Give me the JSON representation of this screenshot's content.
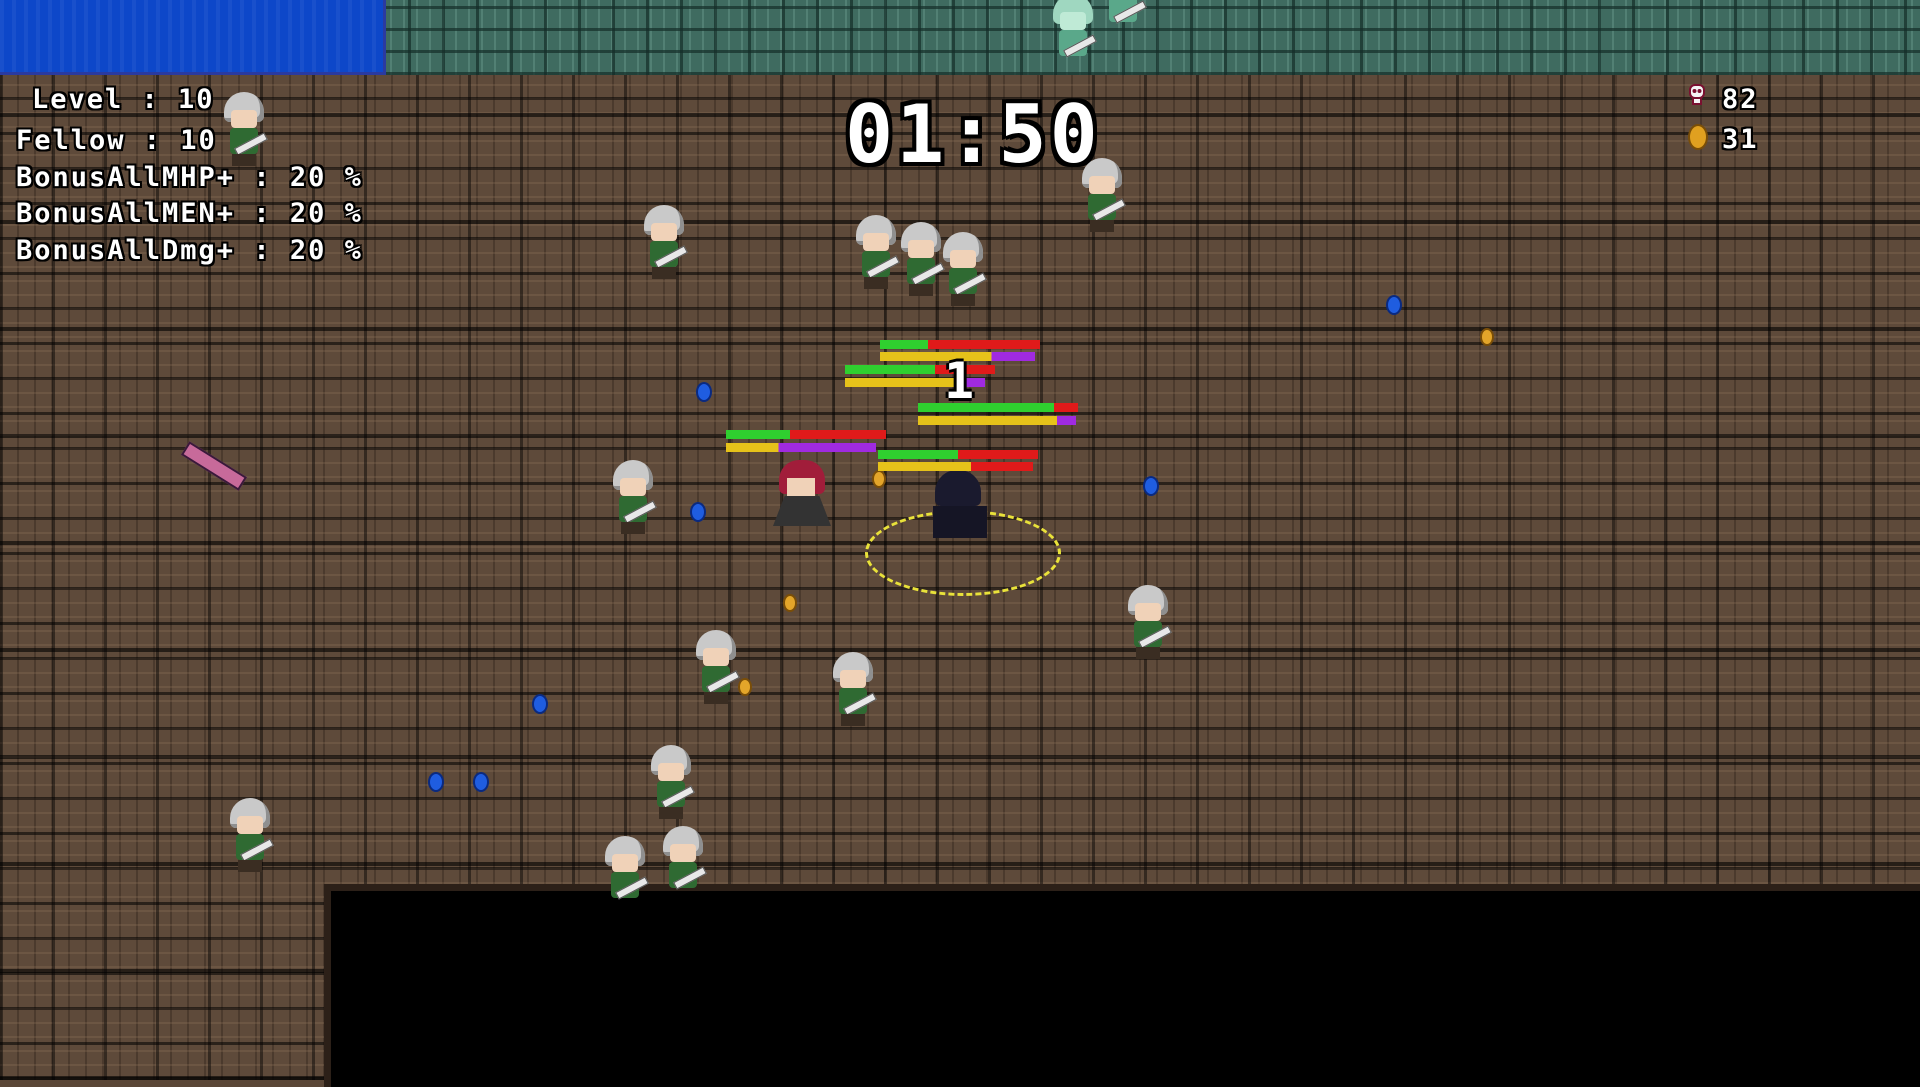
{
  "hud": {
    "level_label": "Level : 10",
    "fellow_label": "Fellow : 10",
    "bonus_mhp": "BonusAllMHP+ : 20 %",
    "bonus_men": "BonusAllMEN+ : 20 %",
    "bonus_dmg": "BonusAllDmg+ : 20 %",
    "timer": "01:50",
    "kills": "82",
    "coins": "31",
    "damage_popup": "1"
  },
  "icons": {
    "kills": "skull-icon",
    "coins": "coin-icon"
  },
  "colors": {
    "water": "#0d47c9",
    "floor": "#5e4a3a",
    "top_wall": "#3f6b60",
    "hp_green": "#2fcf2f",
    "hp_red": "#e01a1a",
    "mp_yellow": "#e6c21a",
    "mp_purple": "#a02ae0"
  }
}
